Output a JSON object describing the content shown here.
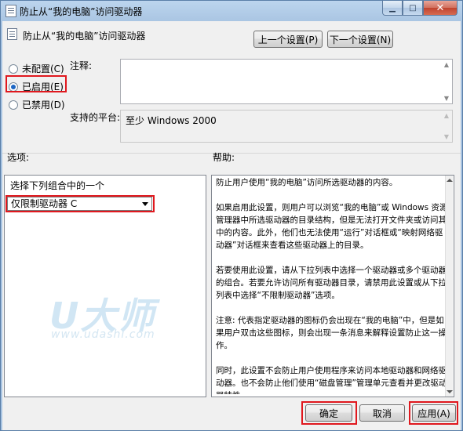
{
  "window": {
    "title": "防止从“我的电脑”访问驱动器",
    "minimize_glyph": "▁",
    "maximize_glyph": "□",
    "close_glyph": "✕"
  },
  "header": {
    "title": "防止从“我的电脑”访问驱动器",
    "prev_label": "上一个设置(P)",
    "next_label": "下一个设置(N)"
  },
  "radios": [
    {
      "label": "未配置(C)",
      "checked": false
    },
    {
      "label": "已启用(E)",
      "checked": true
    },
    {
      "label": "已禁用(D)",
      "checked": false
    }
  ],
  "comment": {
    "label": "注释:",
    "value": ""
  },
  "platform": {
    "label": "支持的平台:",
    "value": "至少 Windows 2000"
  },
  "options": {
    "label": "选项:",
    "prompt": "选择下列组合中的一个",
    "selected": "仅限制驱动器 C"
  },
  "help": {
    "label": "帮助:",
    "paragraphs": [
      "防止用户使用“我的电脑”访问所选驱动器的内容。",
      "如果启用此设置，则用户可以浏览“我的电脑”或 Windows 资源管理器中所选驱动器的目录结构，但是无法打开文件夹或访问其中的内容。此外，他们也无法使用“运行”对话框或“映射网络驱动器”对话框来查看这些驱动器上的目录。",
      "若要使用此设置，请从下拉列表中选择一个驱动器或多个驱动器的组合。若要允许访问所有驱动器目录，请禁用此设置或从下拉列表中选择“不限制驱动器”选项。",
      "注意: 代表指定驱动器的图标仍会出现在“我的电脑”中，但是如果用户双击这些图标，则会出现一条消息来解释设置防止这一操作。",
      "同时，此设置不会防止用户使用程序来访问本地驱动器和网络驱动器。也不会防止他们使用“磁盘管理”管理单元查看并更改驱动器特性。"
    ]
  },
  "watermark": {
    "logo": "U大师",
    "url": "www.udashi.com"
  },
  "buttons": {
    "ok": "确定",
    "cancel": "取消",
    "apply": "应用(A)"
  },
  "colors": {
    "highlight_box": "#e0181e",
    "title_bar": "#a7c3e1",
    "radio_selected": "#1c66c4"
  }
}
